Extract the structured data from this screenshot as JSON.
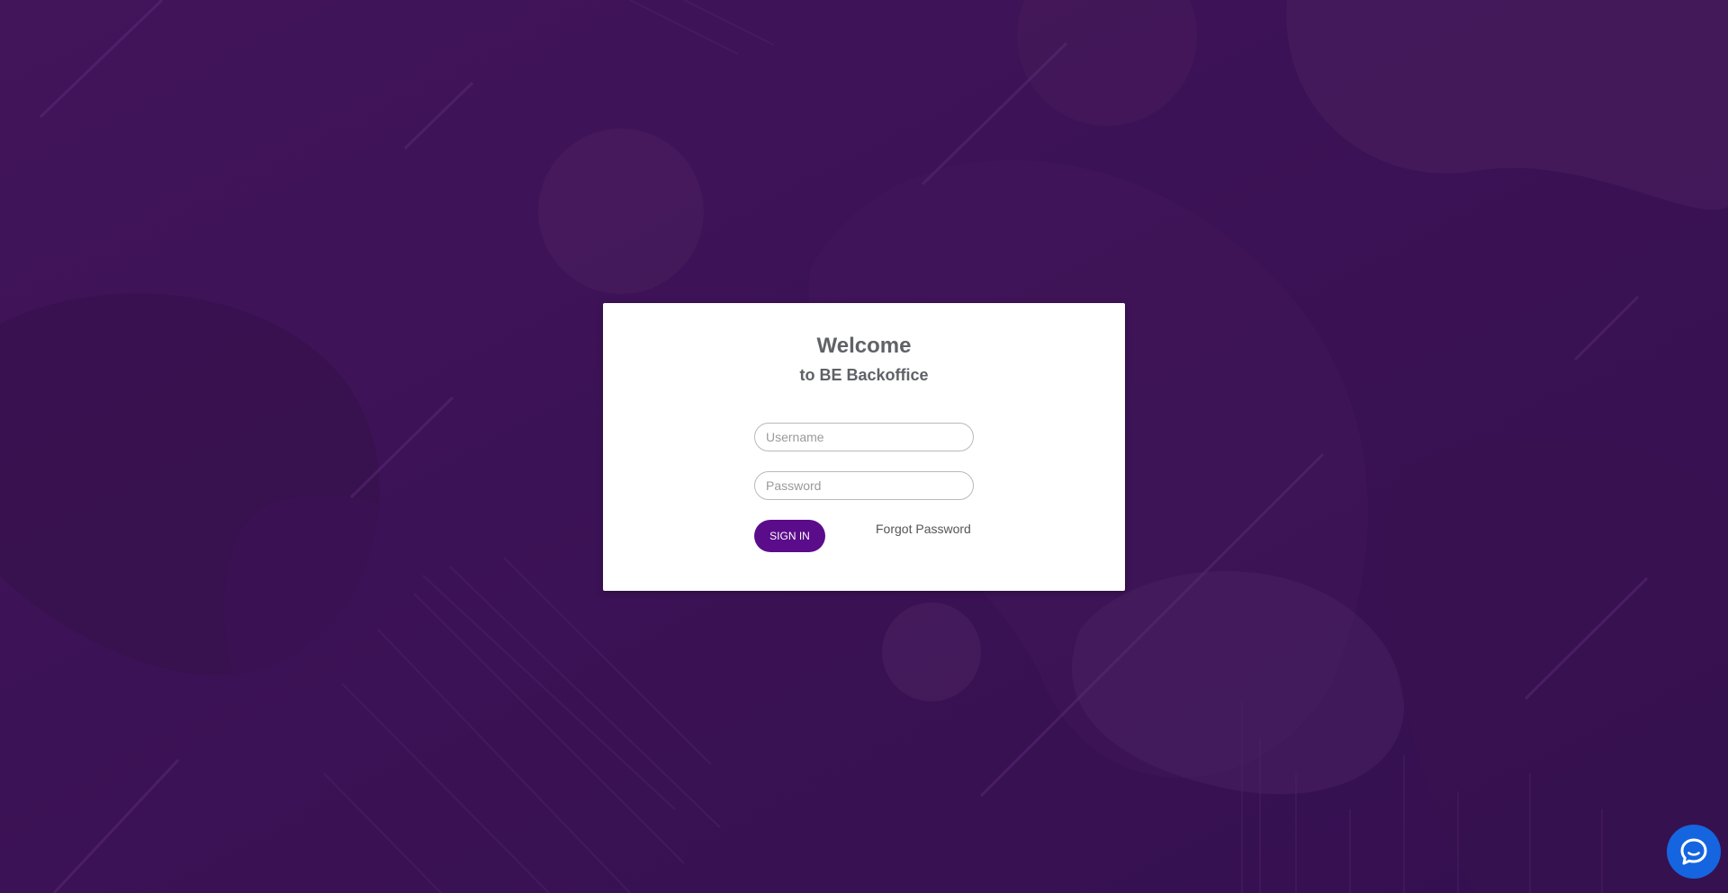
{
  "card": {
    "title": "Welcome",
    "subtitle": "to BE Backoffice"
  },
  "form": {
    "username_placeholder": "Username",
    "username_value": "",
    "password_placeholder": "Password",
    "password_value": "",
    "signin_label": "SIGN IN",
    "forgot_label": "Forgot Password"
  },
  "chat": {
    "icon": "chat-bubble-icon"
  },
  "colors": {
    "background": "#3a1152",
    "accent": "#5b0c8a",
    "chat": "#1565e0",
    "text": "#5f6266"
  }
}
